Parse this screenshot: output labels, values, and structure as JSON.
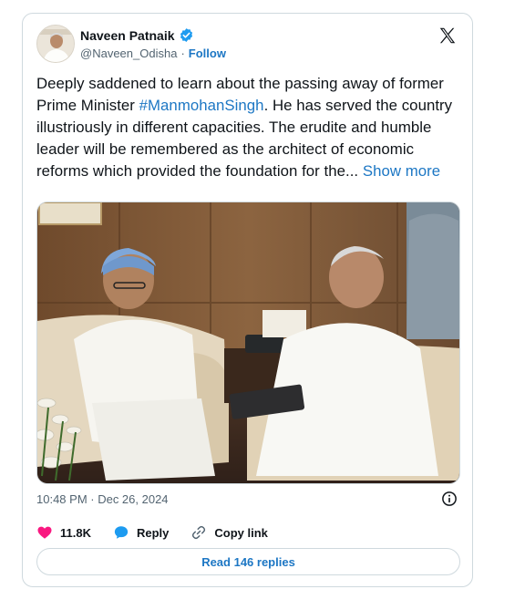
{
  "author": {
    "name": "Naveen Patnaik",
    "handle": "@Naveen_Odisha",
    "separator": "·",
    "follow_label": "Follow"
  },
  "tweet": {
    "text_before": "Deeply saddened to learn about the passing away of former Prime Minister ",
    "hashtag": "#ManmohanSingh",
    "text_after": ". He has served the country illustriously in different capacities. The erudite and humble leader will be remembered as the architect of economic reforms which provided the foundation for the... ",
    "show_more": "Show more",
    "timestamp": "10:48 PM · Dec 26, 2024"
  },
  "actions": {
    "likes": "11.8K",
    "reply_label": "Reply",
    "copy_label": "Copy link"
  },
  "replies_button": "Read 146 replies",
  "colors": {
    "link": "#1d77c4",
    "like": "#f91880",
    "reply": "#1d9bf0",
    "verified": "#1d9bf0"
  },
  "icons": [
    "verified-badge-icon",
    "x-logo-icon",
    "info-icon",
    "heart-icon",
    "reply-bubble-icon",
    "link-icon"
  ]
}
